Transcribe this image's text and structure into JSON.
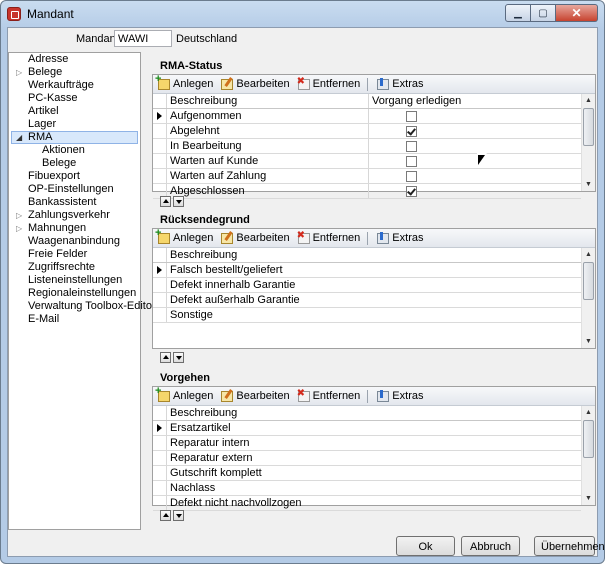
{
  "window": {
    "title": "Mandant",
    "min_icon": "minimize-icon",
    "max_icon": "maximize-icon",
    "close_icon": "close-icon"
  },
  "mandant": {
    "label": "Mandant",
    "value": "WAWI",
    "country": "Deutschland"
  },
  "sidebar": {
    "items": [
      {
        "label": "Adresse",
        "expand": ""
      },
      {
        "label": "Belege",
        "expand": "▷"
      },
      {
        "label": "Werkaufträge",
        "expand": ""
      },
      {
        "label": "PC-Kasse",
        "expand": ""
      },
      {
        "label": "Artikel",
        "expand": ""
      },
      {
        "label": "Lager",
        "expand": ""
      },
      {
        "label": "RMA",
        "expand": "◢"
      },
      {
        "label": "Aktionen",
        "expand": ""
      },
      {
        "label": "Belege",
        "expand": ""
      },
      {
        "label": "Fibuexport",
        "expand": ""
      },
      {
        "label": "OP-Einstellungen",
        "expand": ""
      },
      {
        "label": "Bankassistent",
        "expand": ""
      },
      {
        "label": "Zahlungsverkehr",
        "expand": "▷"
      },
      {
        "label": "Mahnungen",
        "expand": "▷"
      },
      {
        "label": "Waagenanbindung",
        "expand": ""
      },
      {
        "label": "Freie Felder",
        "expand": ""
      },
      {
        "label": "Zugriffsrechte",
        "expand": ""
      },
      {
        "label": "Listeneinstellungen",
        "expand": ""
      },
      {
        "label": "Regionaleinstellungen",
        "expand": ""
      },
      {
        "label": "Verwaltung Toolbox-Editor",
        "expand": ""
      },
      {
        "label": "E-Mail",
        "expand": ""
      }
    ]
  },
  "toolbar": {
    "add": "Anlegen",
    "edit": "Bearbeiten",
    "remove": "Entfernen",
    "extras": "Extras"
  },
  "rma_status": {
    "title": "RMA-Status",
    "col_desc": "Beschreibung",
    "col_check": "Vorgang erledigen",
    "rows": [
      {
        "label": "Aufgenommen",
        "checked": false
      },
      {
        "label": "Abgelehnt",
        "checked": true
      },
      {
        "label": "In Bearbeitung",
        "checked": false
      },
      {
        "label": "Warten auf Kunde",
        "checked": false
      },
      {
        "label": "Warten auf Zahlung",
        "checked": false
      },
      {
        "label": "Abgeschlossen",
        "checked": true
      }
    ]
  },
  "ruecksendegrund": {
    "title": "Rücksendegrund",
    "col_desc": "Beschreibung",
    "rows": [
      "Falsch bestellt/geliefert",
      "Defekt innerhalb Garantie",
      "Defekt außerhalb Garantie",
      "Sonstige"
    ]
  },
  "vorgehen": {
    "title": "Vorgehen",
    "col_desc": "Beschreibung",
    "rows": [
      "Ersatzartikel",
      "Reparatur intern",
      "Reparatur extern",
      "Gutschrift komplett",
      "Nachlass",
      "Defekt nicht nachvollzogen"
    ]
  },
  "footer": {
    "ok": "Ok",
    "cancel": "Abbruch",
    "apply": "Übernehmen"
  }
}
